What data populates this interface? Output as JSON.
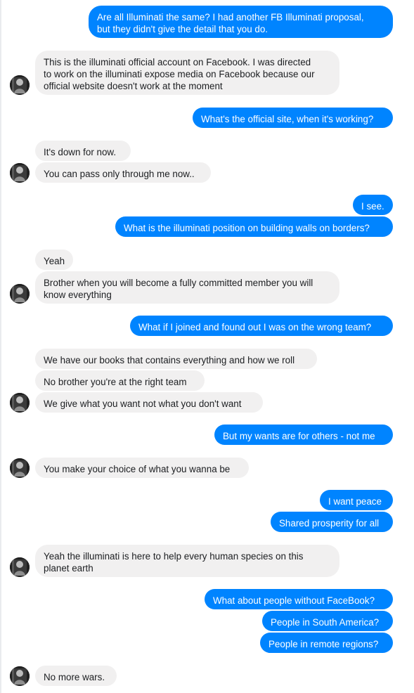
{
  "colors": {
    "outgoing_bubble": "#0084ff",
    "incoming_bubble": "#f1f0f0",
    "incoming_text": "#1c1e21",
    "outgoing_text": "#ffffff"
  },
  "contact": {
    "avatar_icon": "person-silhouette-icon"
  },
  "messages": [
    {
      "from": "me",
      "lines": [
        "Are all Illuminati the same? I had another FB Illuminati proposal,",
        "but they didn't give the detail that you do."
      ]
    },
    {
      "from": "them",
      "lines": [
        "This is the illuminati official account on Facebook. I was directed",
        "to work on the illuminati expose media on Facebook because our",
        "official website doesn't work at the moment"
      ]
    },
    {
      "from": "me",
      "lines": [
        "What's the official site, when it's working?"
      ]
    },
    {
      "from": "them",
      "lines": [
        "It's down for now."
      ]
    },
    {
      "from": "them",
      "lines": [
        "You can pass only through me now.."
      ]
    },
    {
      "from": "me",
      "lines": [
        "I see."
      ]
    },
    {
      "from": "me",
      "lines": [
        "What is the illuminati position on building walls on borders?"
      ]
    },
    {
      "from": "them",
      "lines": [
        "Yeah"
      ]
    },
    {
      "from": "them",
      "lines": [
        "Brother when you will become a fully committed member you will",
        "know everything"
      ]
    },
    {
      "from": "me",
      "lines": [
        "What if I joined and found out I was on the wrong team?"
      ]
    },
    {
      "from": "them",
      "lines": [
        "We have our books that contains everything and how we roll"
      ]
    },
    {
      "from": "them",
      "lines": [
        "No brother you're at the right team"
      ]
    },
    {
      "from": "them",
      "lines": [
        "We give what you want not what you don't want"
      ]
    },
    {
      "from": "me",
      "lines": [
        "But my wants are for others - not me"
      ]
    },
    {
      "from": "them",
      "lines": [
        "You make your choice of what you wanna be"
      ]
    },
    {
      "from": "me",
      "lines": [
        "I want peace"
      ]
    },
    {
      "from": "me",
      "lines": [
        "Shared prosperity for all"
      ]
    },
    {
      "from": "them",
      "lines": [
        "Yeah the illuminati is here to help every human species on this",
        "planet earth"
      ]
    },
    {
      "from": "me",
      "lines": [
        "What about people without FaceBook?"
      ]
    },
    {
      "from": "me",
      "lines": [
        "People in South America?"
      ]
    },
    {
      "from": "me",
      "lines": [
        "People in remote regions?"
      ]
    },
    {
      "from": "them",
      "lines": [
        "No more wars."
      ]
    }
  ]
}
